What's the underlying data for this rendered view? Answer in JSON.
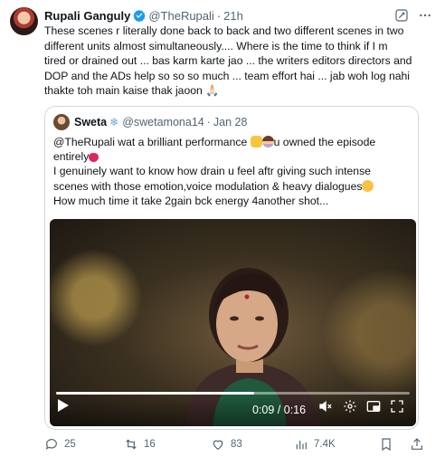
{
  "tweet": {
    "author_name": "Rupali Ganguly",
    "handle": "@TheRupali",
    "separator": "·",
    "time": "21h",
    "text_lines": [
      "These scenes r literally done back to back and two different scenes in two",
      "different units almost simultaneously.... Where is the time to think if I m",
      "tired or drained out ... bas karm karte jao ... the writers editors directors and",
      "DOP and the ADs help so so so much ... team effort hai ... jab woh log nahi",
      "thakte toh main kaise thak jaoon 🙏🏻"
    ]
  },
  "quote": {
    "author_name": "Sweta",
    "handle": "@swetamona14",
    "separator": "·",
    "date": "Jan 28",
    "line1_a": "@TheRupali wat a brilliant performance",
    "line1_b": "u owned the episode",
    "line2": "entirely",
    "line3": "I genuinely want to know how drain u feel aftr giving such intense",
    "line4": "scenes with those emotion,voice modulation & heavy dialogues",
    "line5": "How much time it take 2gain bck energy 4another shot..."
  },
  "video": {
    "time_display": "0:09 / 0:16",
    "progress": 0.56
  },
  "actions": {
    "replies": "25",
    "reposts": "16",
    "likes": "83",
    "views": "7.4K"
  },
  "colors": {
    "verified": "#1d9bf0",
    "muted_text": "#536471",
    "border": "#cfd9de"
  }
}
